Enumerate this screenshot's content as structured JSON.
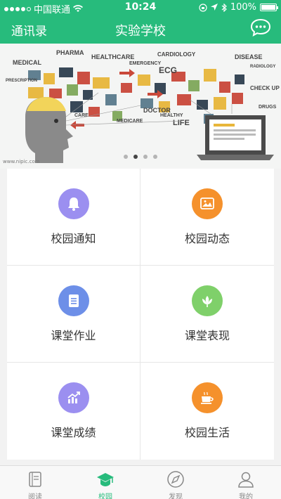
{
  "status_bar": {
    "carrier": "中国联通",
    "time": "10:24",
    "battery": "100%",
    "battery_level": 1.0,
    "signal_bars": 4
  },
  "header": {
    "left_label": "通讯录",
    "title": "实验学校",
    "right_icon": "chat-bubble-icon"
  },
  "banner": {
    "words": [
      "PHARMA",
      "HEALTHCARE",
      "MEDICAL",
      "PRESCRIPTION",
      "EMERGENCY",
      "CARDIOLOGY",
      "DISEASE",
      "RADIOLOGY",
      "ECG",
      "CHECK UP",
      "DRUGS",
      "DOCTOR",
      "CARE",
      "MEDICARE",
      "HEALTHY",
      "LIFE"
    ],
    "watermark": "www.nipic.com",
    "page_count": 4,
    "active_page": 1
  },
  "grid": {
    "items": [
      {
        "label": "校园通知",
        "icon": "bell-icon",
        "color": "#9b8ff0"
      },
      {
        "label": "校园动态",
        "icon": "image-icon",
        "color": "#f5912c"
      },
      {
        "label": "课堂作业",
        "icon": "document-icon",
        "color": "#6d8fe8"
      },
      {
        "label": "课堂表现",
        "icon": "lotus-icon",
        "color": "#7fd06a"
      },
      {
        "label": "课堂成绩",
        "icon": "chart-icon",
        "color": "#9b8ff0"
      },
      {
        "label": "校园生活",
        "icon": "coffee-icon",
        "color": "#f5912c"
      }
    ]
  },
  "tabbar": {
    "tabs": [
      {
        "label": "阅读",
        "icon": "book-icon",
        "active": false
      },
      {
        "label": "校园",
        "icon": "graduation-cap-icon",
        "active": true
      },
      {
        "label": "发现",
        "icon": "compass-icon",
        "active": false
      },
      {
        "label": "我的",
        "icon": "user-icon",
        "active": false
      }
    ]
  },
  "colors": {
    "primary": "#27bb7c",
    "tab_inactive": "#888888"
  }
}
